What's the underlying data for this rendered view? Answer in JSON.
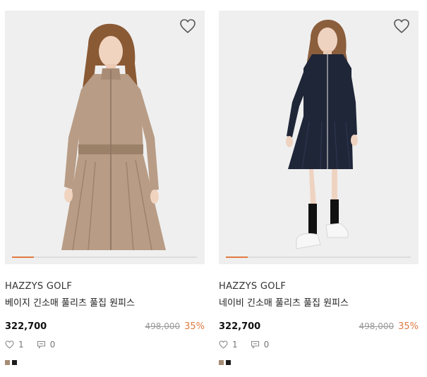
{
  "products": [
    {
      "brand": "HAZZYS GOLF",
      "name": "베이지 긴소매 풀리츠 풀집 원피스",
      "price": "322,700",
      "original_price": "498,000",
      "discount": "35%",
      "likes": "1",
      "reviews": "0",
      "dress_color": "#b89c85",
      "swatches": [
        "#a68c74",
        "#1c1c1c"
      ],
      "slide_progress": 0.12
    },
    {
      "brand": "HAZZYS GOLF",
      "name": "네이비 긴소매 풀리츠 풀집 원피스",
      "price": "322,700",
      "original_price": "498,000",
      "discount": "35%",
      "likes": "1",
      "reviews": "0",
      "dress_color": "#1f2638",
      "swatches": [
        "#a68c74",
        "#1c1c1c"
      ],
      "slide_progress": 0.12
    }
  ],
  "colors": {
    "accent": "#e07a3f",
    "muted": "#9a9a9a"
  }
}
